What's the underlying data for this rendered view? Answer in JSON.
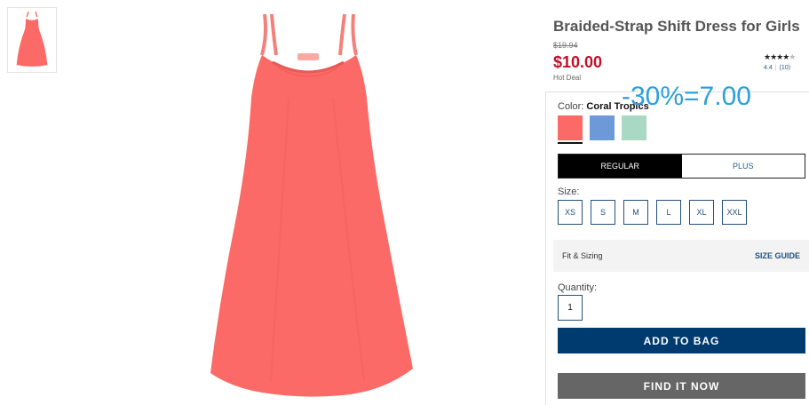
{
  "product": {
    "title": "Braided-Strap Shift Dress for Girls",
    "was_price": "$19.94",
    "sale_price": "$10.00",
    "deal_label": "Hot Deal"
  },
  "rating": {
    "stars_filled": "★★★★",
    "stars_empty": "★",
    "score": "4.4",
    "count": "(10)",
    "value": 4.4
  },
  "promo_note": "-30%=7.00",
  "color": {
    "label": "Color:",
    "selected_name": "Coral Tropics",
    "swatches": [
      {
        "name": "Coral Tropics",
        "hex": "#fb6a66"
      },
      {
        "name": "Blue",
        "hex": "#6e99d8"
      },
      {
        "name": "Mint",
        "hex": "#a9d8c5"
      }
    ]
  },
  "fit_tabs": [
    "REGULAR",
    "PLUS"
  ],
  "size": {
    "label": "Size:",
    "options": [
      "XS",
      "S",
      "M",
      "L",
      "XL",
      "XXL"
    ]
  },
  "fit_sizing": {
    "label": "Fit & Sizing",
    "link": "SIZE GUIDE"
  },
  "quantity": {
    "label": "Quantity:",
    "value": "1"
  },
  "buttons": {
    "add_to_bag": "ADD TO BAG",
    "find_it_now": "FIND IT NOW"
  },
  "colors": {
    "dress": "#fb6a66",
    "brand_blue": "#003b6f",
    "price_red": "#c0102a",
    "promo_blue": "#2b9fe0"
  }
}
